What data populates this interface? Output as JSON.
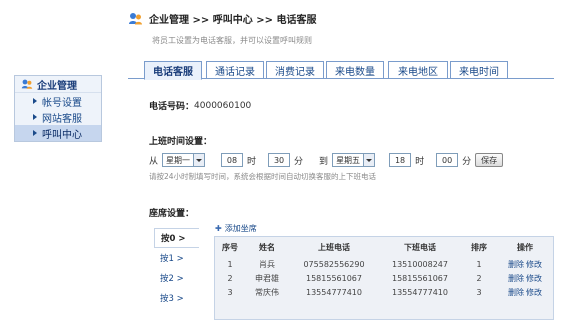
{
  "header": {
    "title": "企业管理 >> 呼叫中心 >> 电话客服",
    "description": "将员工设置为电话客服，并可以设置呼叫规则"
  },
  "sidebar": {
    "title": "企业管理",
    "items": [
      {
        "label": "帐号设置"
      },
      {
        "label": "网站客服"
      },
      {
        "label": "呼叫中心"
      }
    ]
  },
  "tabs": [
    {
      "label": "电话客服"
    },
    {
      "label": "通话记录"
    },
    {
      "label": "消费记录"
    },
    {
      "label": "来电数量"
    },
    {
      "label": "来电地区"
    },
    {
      "label": "来电时间"
    }
  ],
  "phone": {
    "label": "电话号码：",
    "value": "4000060100"
  },
  "worktime": {
    "label": "上班时间设置：",
    "from": "从",
    "start_day": "星期一",
    "start_hour": "08",
    "hour_unit": "时",
    "start_minute": "30",
    "minute_unit": "分",
    "to": "到",
    "end_day": "星期五",
    "end_hour": "18",
    "end_minute": "00",
    "save_label": "保存",
    "hint": "请按24小时制填写时间，系统会根据时间自动切换客服的上下班电话"
  },
  "seats": {
    "label": "座席设置：",
    "add_label": "添加坐席",
    "keys": [
      "按0 >",
      "按1 >",
      "按2 >",
      "按3 >"
    ],
    "columns": [
      "序号",
      "姓名",
      "上班电话",
      "下班电话",
      "排序",
      "操作"
    ],
    "rows": [
      {
        "no": "1",
        "name": "肖兵",
        "work_phone": "075582556290",
        "off_phone": "13510008247",
        "order": "1",
        "delete": "删除",
        "edit": "修改"
      },
      {
        "no": "2",
        "name": "申君雄",
        "work_phone": "15815561067",
        "off_phone": "15815561067",
        "order": "2",
        "delete": "删除",
        "edit": "修改"
      },
      {
        "no": "3",
        "name": "常庆伟",
        "work_phone": "13554777410",
        "off_phone": "13554777410",
        "order": "3",
        "delete": "删除",
        "edit": "修改"
      }
    ]
  },
  "colors": {
    "accent": "#1a4a8a",
    "tab_border": "#7a9ccc",
    "sidebar_bg": "#eef3fa"
  }
}
